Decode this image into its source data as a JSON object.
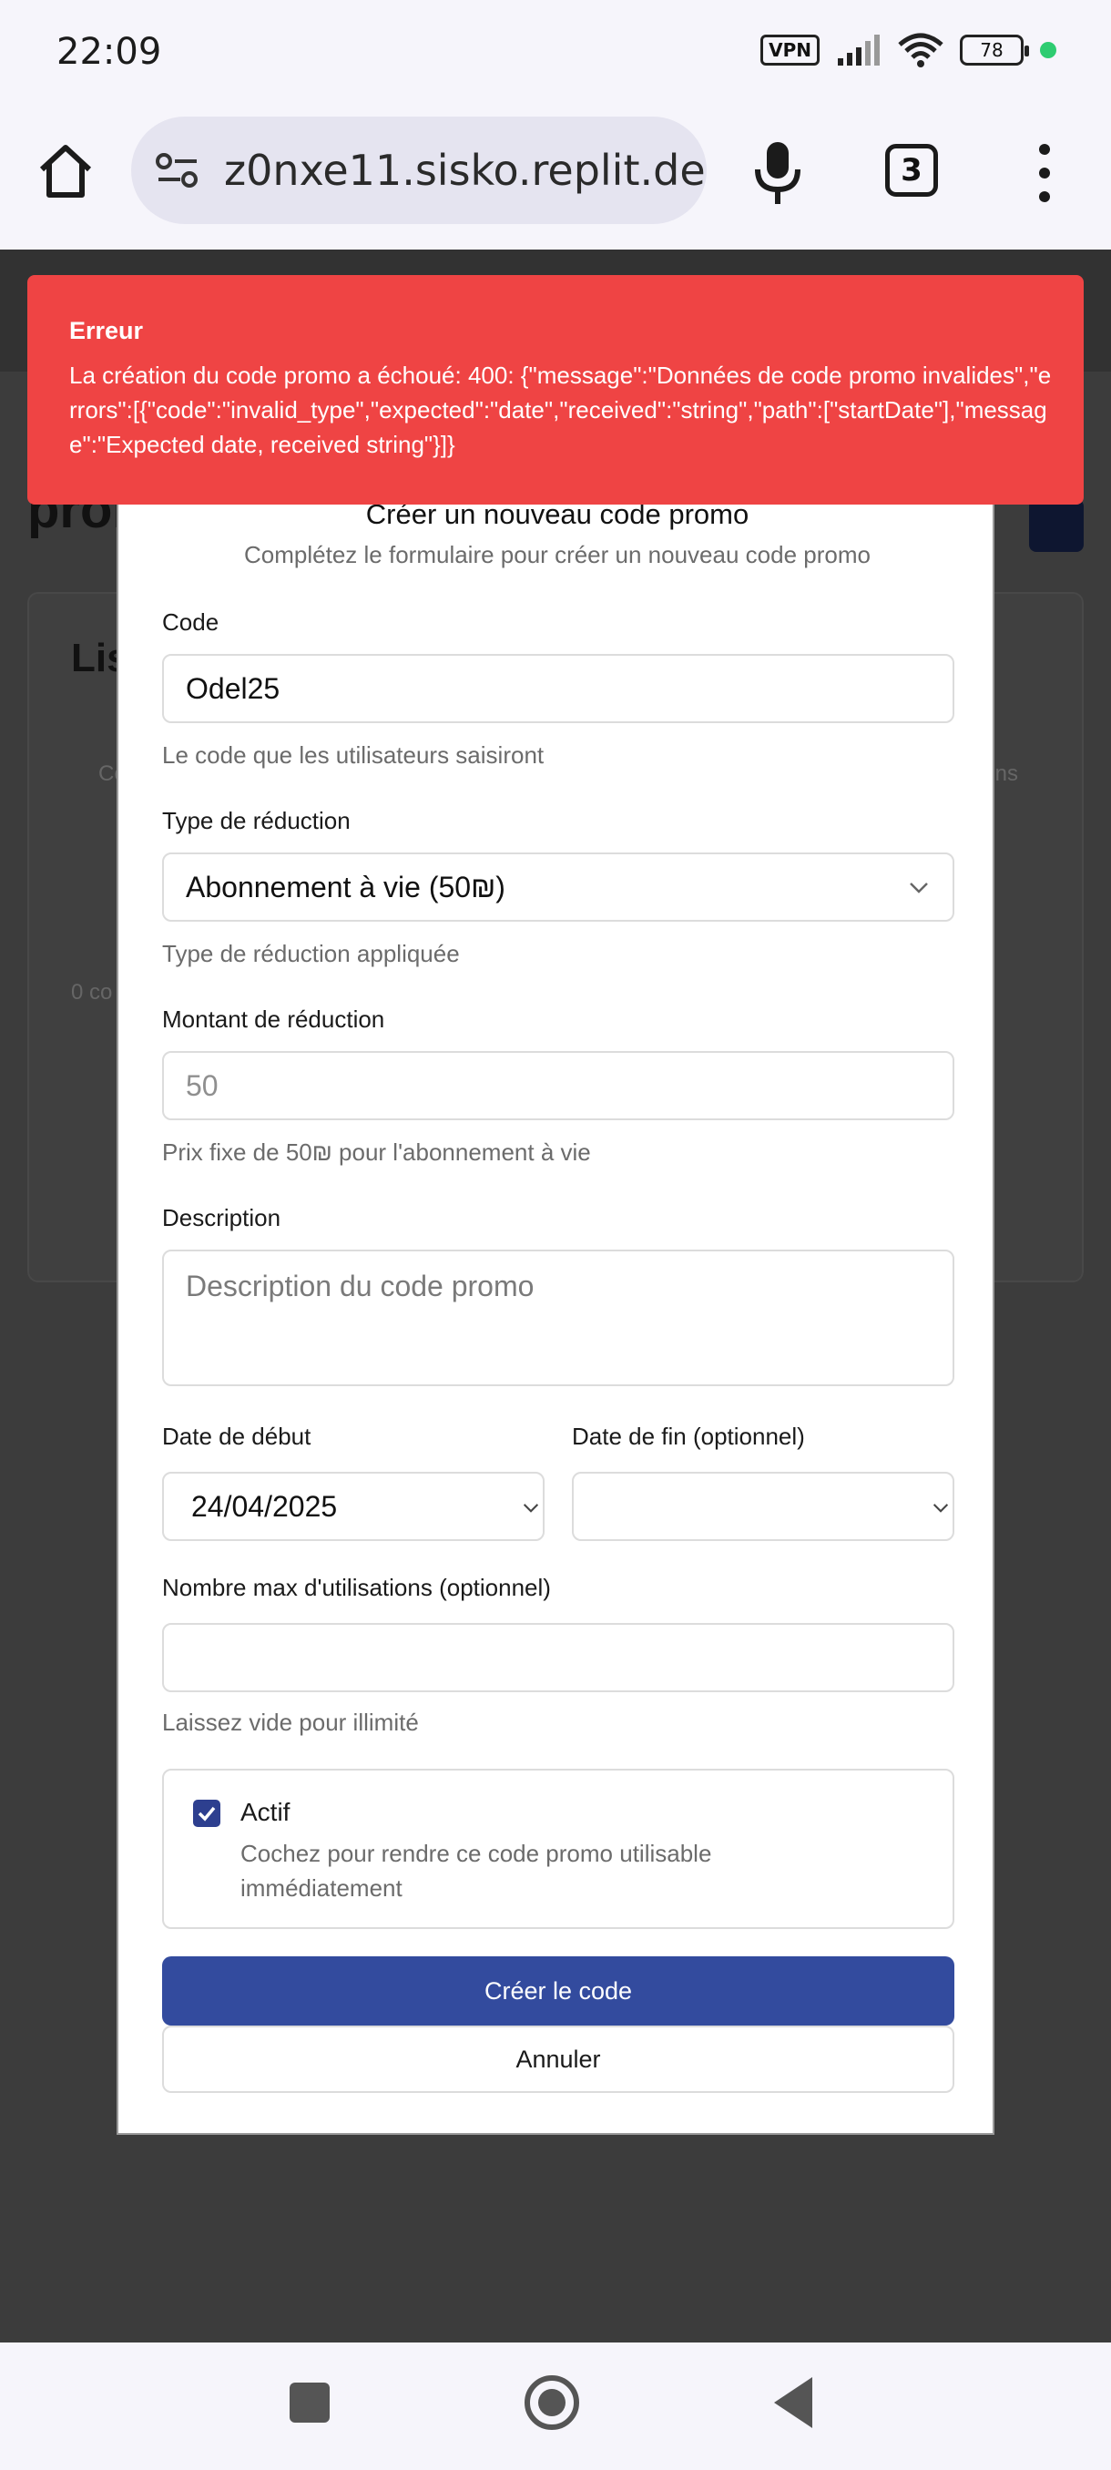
{
  "status_bar": {
    "time": "22:09",
    "vpn_label": "VPN",
    "battery_level": "78",
    "icons": [
      "vpn-icon",
      "signal-icon",
      "wifi-icon",
      "battery-icon",
      "active-dot-icon"
    ]
  },
  "browser": {
    "url": "z0nxe11.sisko.replit.dev",
    "tab_count": "3",
    "icons": [
      "home-icon",
      "site-settings-icon",
      "mic-icon",
      "tabs-icon",
      "more-vert-icon"
    ]
  },
  "background_page": {
    "title_fragment": "pror",
    "card_title_fragment": "Lis",
    "column_left_fragment": "Co",
    "column_right_fragment": "ns",
    "count_fragment": "0 co"
  },
  "toast": {
    "title": "Erreur",
    "message": "La création du code promo a échoué: 400: {\"message\":\"Données de code promo invalides\",\"errors\":[{\"code\":\"invalid_type\",\"expected\":\"date\",\"received\":\"string\",\"path\":[\"startDate\"],\"message\":\"Expected date, received string\"}]}",
    "color": "#ef4444"
  },
  "modal": {
    "title": "Créer un nouveau code promo",
    "subtitle": "Complétez le formulaire pour créer un nouveau code promo",
    "code_label": "Code",
    "code_value": "Odel25",
    "code_hint": "Le code que les utilisateurs saisiront",
    "type_label": "Type de réduction",
    "type_value": "Abonnement à vie (50₪)",
    "type_hint": "Type de réduction appliquée",
    "amount_label": "Montant de réduction",
    "amount_value": "50",
    "amount_hint": "Prix fixe de 50₪ pour l'abonnement à vie",
    "description_label": "Description",
    "description_placeholder": "Description du code promo",
    "start_label": "Date de début",
    "start_value": "24/04/2025",
    "end_label": "Date de fin (optionnel)",
    "end_value": "",
    "max_label": "Nombre max d'utilisations (optionnel)",
    "max_value": "",
    "max_hint": "Laissez vide pour illimité",
    "active_label": "Actif",
    "active_checked": true,
    "active_desc": "Cochez pour rendre ce code promo utilisable immédiatement",
    "create_button": "Créer le code",
    "cancel_button": "Annuler",
    "primary_color": "#334b9e"
  },
  "nav": {
    "icons": [
      "recents-icon",
      "home-circle-icon",
      "back-icon"
    ]
  }
}
